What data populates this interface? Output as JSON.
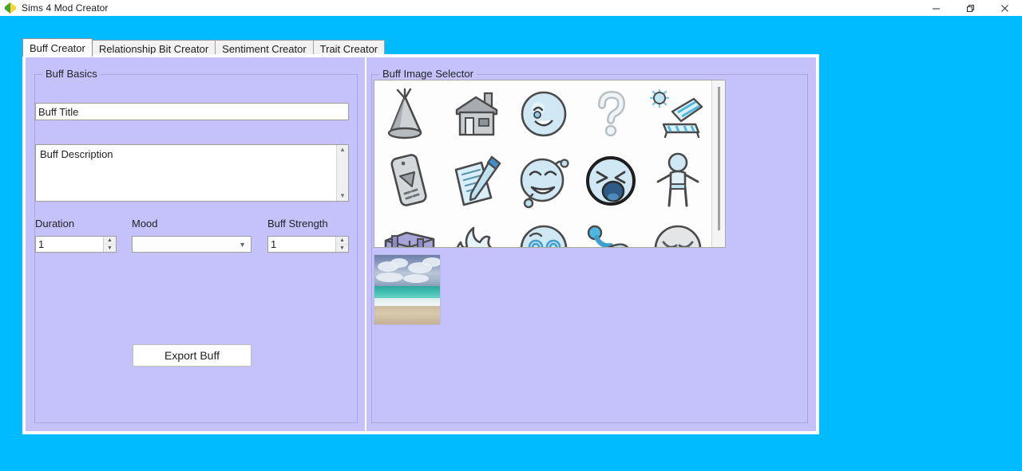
{
  "window": {
    "title": "Sims 4 Mod Creator",
    "icon": "plumbob-icon",
    "controls": [
      {
        "name": "minimize-button",
        "glyph": "minimize-icon"
      },
      {
        "name": "restore-button",
        "glyph": "restore-icon"
      },
      {
        "name": "close-button",
        "glyph": "close-icon"
      }
    ]
  },
  "theme": {
    "desktop_background": "#00bbff",
    "panel_background": "#c4c1fb",
    "frame_border": "#ffffff",
    "group_border": "#a9a6d8",
    "text": "#222222",
    "input_background": "#ffffff",
    "tab_active_background": "#ffffff",
    "tab_inactive_background": "#f2f2f2"
  },
  "tabs": [
    {
      "label": "Buff Creator",
      "active": true
    },
    {
      "label": "Relationship Bit Creator",
      "active": false
    },
    {
      "label": "Sentiment Creator",
      "active": false
    },
    {
      "label": "Trait Creator",
      "active": false
    }
  ],
  "buff_basics": {
    "group_label": "Buff Basics",
    "title_field": {
      "value": "Buff Title",
      "placeholder": "Buff Title"
    },
    "description_field": {
      "value": "Buff Description",
      "placeholder": "Buff Description"
    },
    "duration": {
      "label": "Duration",
      "value": "1"
    },
    "mood": {
      "label": "Mood",
      "value": "",
      "placeholder": ""
    },
    "buff_strength": {
      "label": "Buff Strength",
      "value": "1"
    },
    "export_button": "Export Buff"
  },
  "buff_image_selector": {
    "group_label": "Buff Image Selector",
    "columns": 5,
    "icons": [
      {
        "name": "party-hat-icon",
        "row": 1,
        "col": 1
      },
      {
        "name": "house-icon",
        "row": 1,
        "col": 2
      },
      {
        "name": "smiling-face-icon",
        "row": 1,
        "col": 3
      },
      {
        "name": "question-mark-icon",
        "row": 1,
        "col": 4
      },
      {
        "name": "sun-lounger-icon",
        "row": 1,
        "col": 5
      },
      {
        "name": "mobile-phone-icon",
        "row": 2,
        "col": 1
      },
      {
        "name": "notepad-pen-icon",
        "row": 2,
        "col": 2
      },
      {
        "name": "laughing-face-icon",
        "row": 2,
        "col": 3
      },
      {
        "name": "yawning-face-icon",
        "row": 2,
        "col": 4
      },
      {
        "name": "standing-person-icon",
        "row": 2,
        "col": 5
      },
      {
        "name": "luggage-icon",
        "row": 3,
        "col": 1
      },
      {
        "name": "flame-icon",
        "row": 3,
        "col": 2
      },
      {
        "name": "dizzy-face-icon",
        "row": 3,
        "col": 3
      },
      {
        "name": "water-splash-icon",
        "row": 3,
        "col": 4
      },
      {
        "name": "sad-face-icon",
        "row": 3,
        "col": 5
      }
    ],
    "scrollbar": {
      "orientation": "vertical",
      "thumb_position": "top"
    },
    "preview": {
      "name": "beach-photo-preview",
      "description": "beach with clouds, turquoise sea and sand"
    }
  }
}
